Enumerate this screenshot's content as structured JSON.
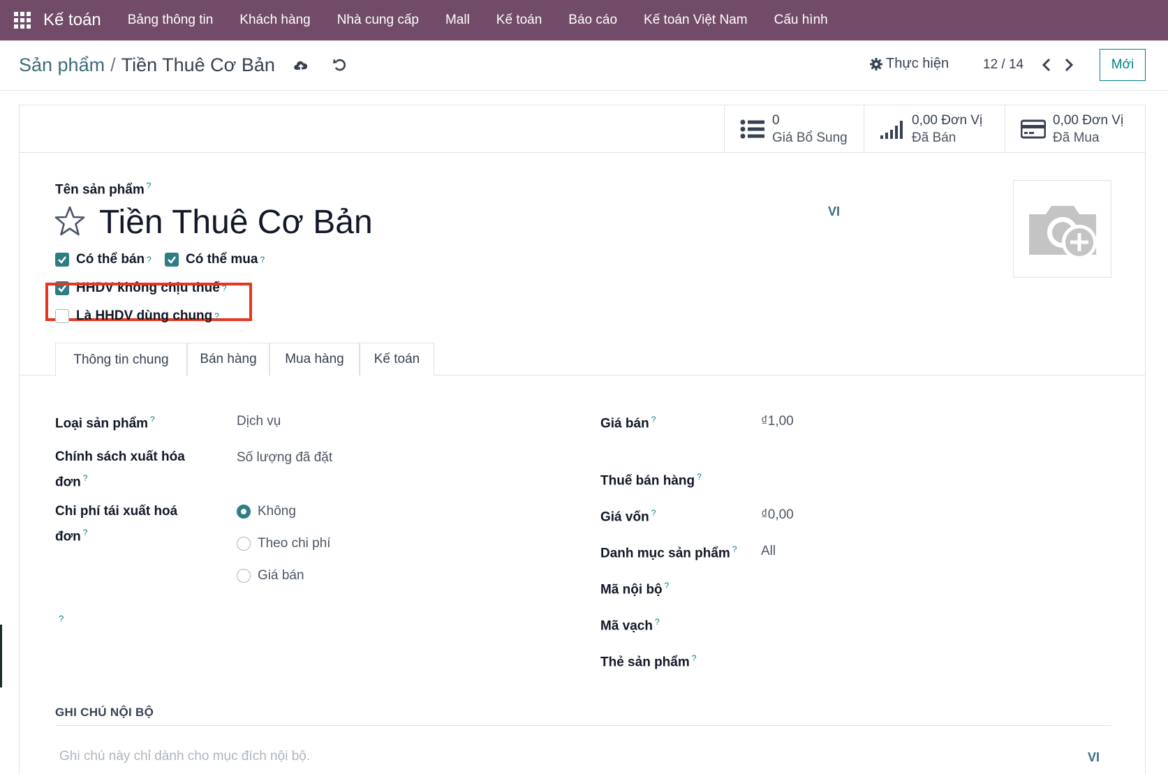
{
  "navbar": {
    "brand": "Kế toán",
    "menu": [
      "Bảng thông tin",
      "Khách hàng",
      "Nhà cung cấp",
      "Mall",
      "Kế toán",
      "Báo cáo",
      "Kế toán Việt Nam",
      "Cấu hình"
    ],
    "color": "#714b67"
  },
  "control": {
    "breadcrumb_parent": "Sản phẩm",
    "breadcrumb_sep": "/",
    "breadcrumb_current": "Tiền Thuê Cơ Bản",
    "action_label": "Thực hiện",
    "pager": "12 / 14",
    "new_label": "Mới"
  },
  "stats": [
    {
      "value": "0",
      "label": "Giá Bổ Sung",
      "icon": "list-icon"
    },
    {
      "value": "0,00 Đơn Vị",
      "label": "Đã Bán",
      "icon": "signal-icon"
    },
    {
      "value": "0,00 Đơn Vị",
      "label": "Đã Mua",
      "icon": "credit-card-icon"
    }
  ],
  "product": {
    "name_label": "Tên sản phẩm",
    "name": "Tiền Thuê Cơ Bản",
    "lang": "VI",
    "help": "?"
  },
  "checks": {
    "can_sell": {
      "label": "Có thể bán",
      "checked": true
    },
    "can_buy": {
      "label": "Có thể mua",
      "checked": true
    },
    "tax_exempt": {
      "label": "HHDV không chịu thuế",
      "checked": true
    },
    "shared": {
      "label": "Là HHDV dùng chung",
      "checked": false
    }
  },
  "tabs": [
    "Thông tin chung",
    "Bán hàng",
    "Mua hàng",
    "Kế toán"
  ],
  "left_fields": {
    "type_label": "Loại sản phẩm",
    "type_value": "Dịch vụ",
    "invoice_policy_label_1": "Chính sách xuất hóa",
    "invoice_policy_label_2": "đơn",
    "invoice_policy_value": "Số lượng đã đặt",
    "reinvoice_label_1": "Chi phí tái xuất hoá",
    "reinvoice_label_2": "đơn",
    "reinvoice_options": [
      "Không",
      "Theo chi phí",
      "Giá bán"
    ],
    "reinvoice_selected": "Không"
  },
  "right_fields": {
    "sale_price_label": "Giá bán",
    "sale_price": "₫1,00",
    "sale_tax_label": "Thuế bán hàng",
    "cost_label": "Giá vốn",
    "cost": "₫0,00",
    "category_label": "Danh mục sản phẩm",
    "category": "All",
    "internal_ref_label": "Mã nội bộ",
    "barcode_label": "Mã vạch",
    "tags_label": "Thẻ sản phẩm"
  },
  "notes": {
    "title": "GHI CHÚ NỘI BỘ",
    "placeholder": "Ghi chú này chỉ dành cho mục đích nội bộ.",
    "lang": "VI"
  },
  "accent": "#017e84",
  "highlight_color": "#e8351f"
}
